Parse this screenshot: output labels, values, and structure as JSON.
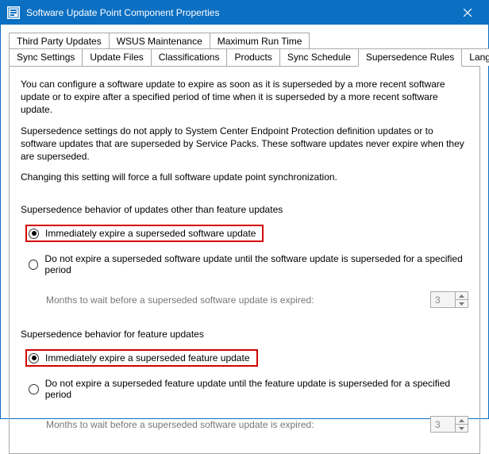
{
  "window": {
    "title": "Software Update Point Component Properties"
  },
  "tabs": {
    "row1": [
      "Third Party Updates",
      "WSUS Maintenance",
      "Maximum Run Time"
    ],
    "row2": [
      "Sync Settings",
      "Update Files",
      "Classifications",
      "Products",
      "Sync Schedule",
      "Supersedence Rules",
      "Languages"
    ],
    "active": "Supersedence Rules"
  },
  "panel": {
    "intro1": "You can configure a software update to expire as soon as it is superseded by a more recent software update or to expire after a specified period of time when it is superseded by a more recent software update.",
    "intro2": "Supersedence settings do not apply to System Center Endpoint Protection definition updates or to software updates that are superseded by Service Packs. These software updates never expire when they are superseded.",
    "intro3": "Changing this setting will force a full software update point synchronization.",
    "group1": {
      "legend": "Supersedence behavior of updates other than feature updates",
      "opt1": "Immediately expire a superseded software update",
      "opt2": "Do not expire a superseded software update until the software update is superseded for a specified period",
      "months_label": "Months to wait before a superseded software update is expired:",
      "months_value": "3"
    },
    "group2": {
      "legend": "Supersedence behavior for feature updates",
      "opt1": "Immediately expire a superseded feature update",
      "opt2": "Do not expire a superseded feature update until the feature update is superseded for a specified period",
      "months_label": "Months to wait before a superseded software update is expired:",
      "months_value": "3"
    }
  }
}
